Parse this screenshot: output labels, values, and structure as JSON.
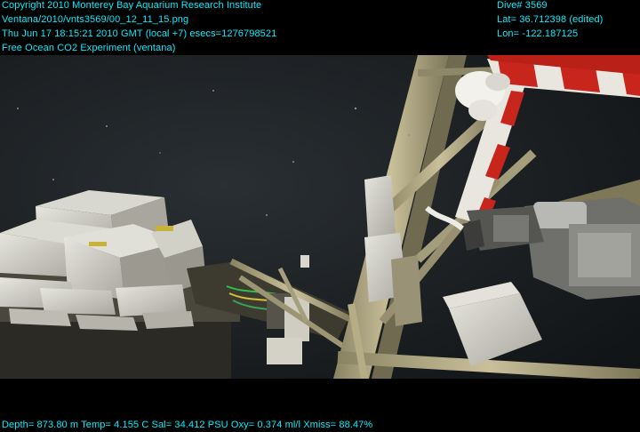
{
  "overlay": {
    "top_left": [
      "Copyright 2010 Monterey Bay Aquarium Research Institute",
      "Ventana/2010/vnts3569/00_12_11_15.png",
      "Thu Jun 17 18:15:21 2010 GMT (local +7)  esecs=1276798521",
      "Free Ocean CO2 Experiment (ventana)"
    ],
    "top_right": [
      "Dive# 3569",
      "Lat= 36.712398 (edited)",
      "Lon= -122.187125"
    ],
    "bottom": "Depth= 873.80 m  Temp= 4.155 C  Sal= 34.412 PSU  Oxy= 0.374 ml/l  Xmiss= 88.47%"
  },
  "colors": {
    "overlay_text": "#00f0ff",
    "water": "#1e2226",
    "frame_beam": "#b9b08a",
    "stripe_red": "#c8251d",
    "stripe_white": "#e9e6df",
    "box": "#d8d6cc"
  }
}
